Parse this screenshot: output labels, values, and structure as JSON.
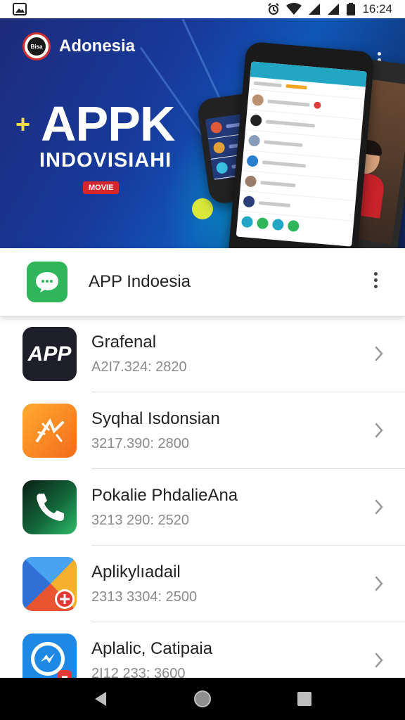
{
  "status_bar": {
    "time": "16:24",
    "icons": [
      "image-icon",
      "alarm-icon",
      "wifi-icon",
      "signal-icon",
      "signal-icon",
      "battery-icon"
    ]
  },
  "banner": {
    "brand": "Adonesia",
    "logo_text": "Bisa",
    "title": "APPK",
    "subtitle": "INDOVISIAHI",
    "tag": "MOVIE",
    "plus_symbol": "+",
    "menu_icon": "more-vert-icon"
  },
  "featured_app": {
    "label": "APP Indoesia",
    "icon": "chat-bubble-icon",
    "menu_icon": "more-vert-icon"
  },
  "apps": [
    {
      "name": "Grafenal",
      "meta": "A2I7.324: 2820",
      "icon": "app-logo-icon",
      "icon_text": "APP"
    },
    {
      "name": "Syqhal Isdonsian",
      "meta": "3217.390: 2800",
      "icon": "spark-icon"
    },
    {
      "name": "Pokalie PhdalieAna",
      "meta": "3213 290: 2520",
      "icon": "phone-icon"
    },
    {
      "name": "Aplikylıadail",
      "meta": "2313 3304: 2500",
      "icon": "play-plus-icon"
    },
    {
      "name": "Aplalic, Catipaia",
      "meta": "2I12 233: 3600",
      "icon": "messenger-icon"
    }
  ],
  "nav": {
    "back": "back-icon",
    "home": "home-icon",
    "recents": "recents-icon"
  },
  "colors": {
    "banner_dark": "#173a9c",
    "accent_green": "#2fb55a",
    "accent_red": "#d8262f",
    "accent_yellow": "#d9e83a",
    "text_secondary": "#8a8a8a"
  }
}
